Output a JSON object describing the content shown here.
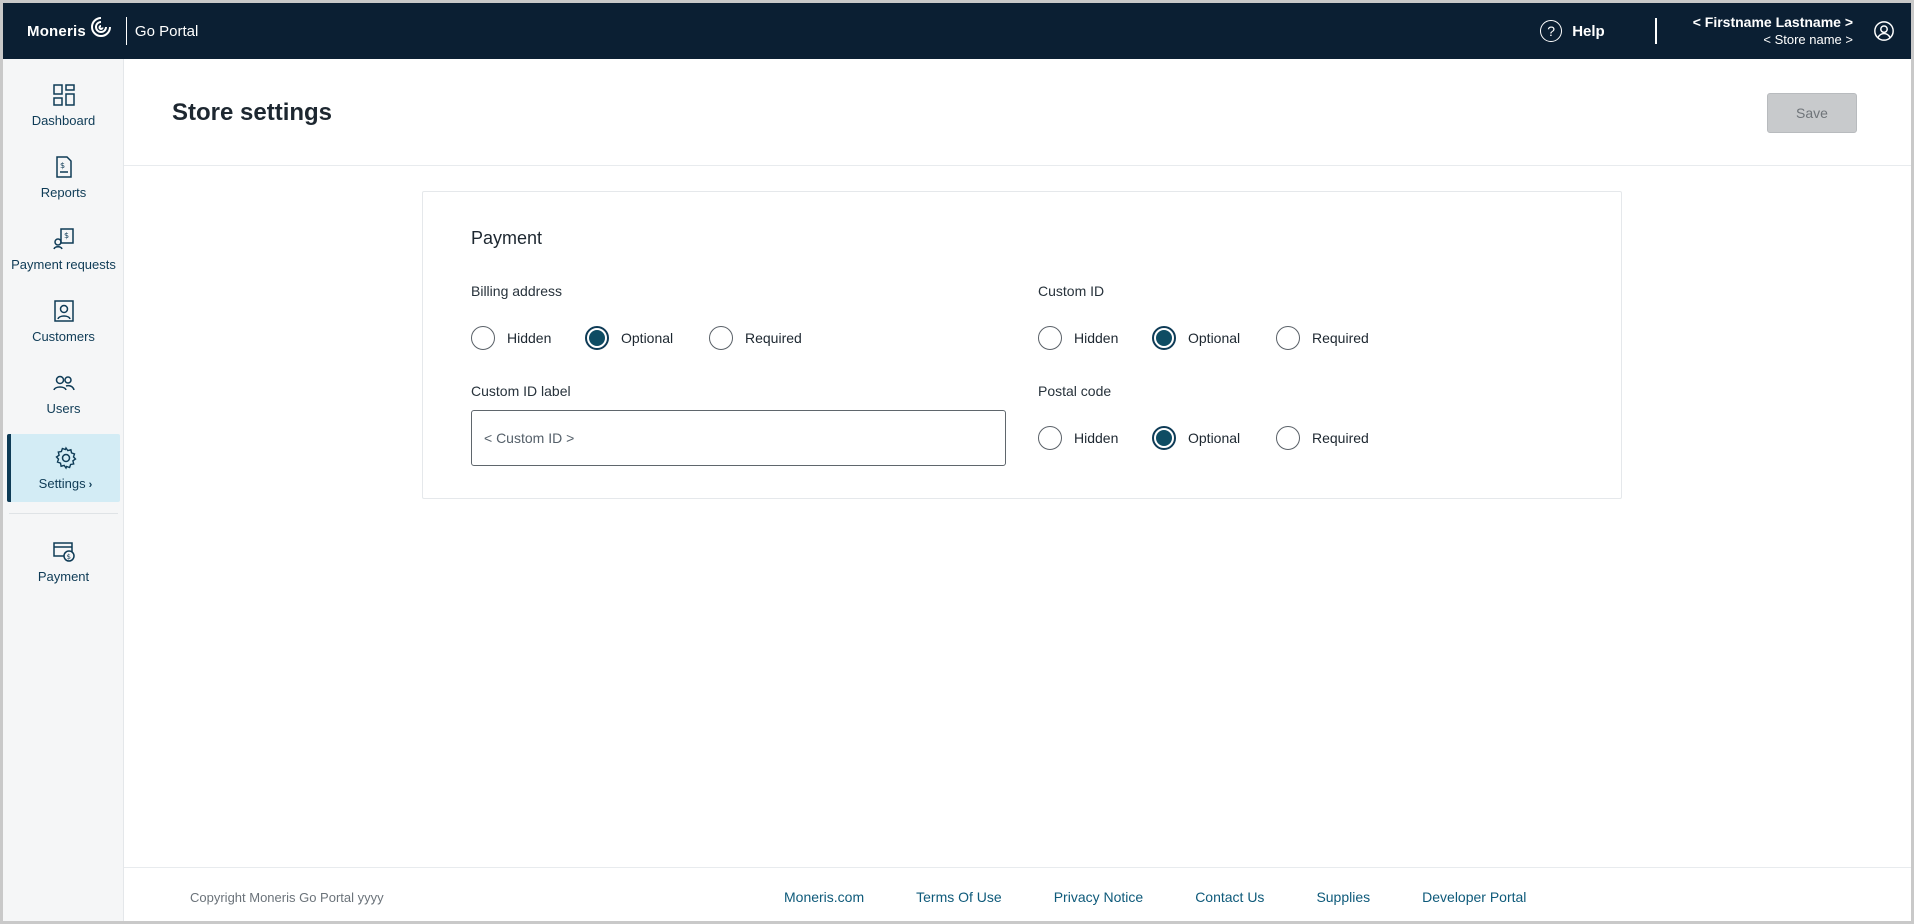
{
  "header": {
    "logo_text": "Moneris",
    "app_name": "Go Portal",
    "help_label": "Help",
    "user_name": "< Firstname Lastname >",
    "store_name": "< Store name >"
  },
  "sidebar": {
    "items": [
      {
        "label": "Dashboard",
        "icon": "dashboard-icon"
      },
      {
        "label": "Reports",
        "icon": "reports-icon"
      },
      {
        "label": "Payment requests",
        "icon": "payment-requests-icon"
      },
      {
        "label": "Customers",
        "icon": "customers-icon"
      },
      {
        "label": "Users",
        "icon": "users-icon"
      },
      {
        "label": "Settings",
        "icon": "settings-icon",
        "active": true
      },
      {
        "label": "Payment",
        "icon": "payment-icon"
      }
    ]
  },
  "page": {
    "title": "Store settings",
    "save_label": "Save"
  },
  "card": {
    "title": "Payment",
    "billing_address": {
      "label": "Billing address",
      "options": [
        "Hidden",
        "Optional",
        "Required"
      ],
      "selected": "Optional"
    },
    "custom_id": {
      "label": "Custom ID",
      "options": [
        "Hidden",
        "Optional",
        "Required"
      ],
      "selected": "Optional"
    },
    "custom_id_label": {
      "label": "Custom ID label",
      "placeholder": "< Custom ID >"
    },
    "postal_code": {
      "label": "Postal code",
      "options": [
        "Hidden",
        "Optional",
        "Required"
      ],
      "selected": "Optional"
    }
  },
  "footer": {
    "copyright": "Copyright Moneris Go Portal  yyyy",
    "links": [
      "Moneris.com",
      "Terms Of Use",
      "Privacy Notice",
      "Contact Us",
      "Supplies",
      "Developer Portal"
    ]
  },
  "colors": {
    "topbar": "#0b1f33",
    "accent": "#0e3b56",
    "active_nav_bg": "#d3ecf5",
    "link": "#0e5a7a"
  }
}
